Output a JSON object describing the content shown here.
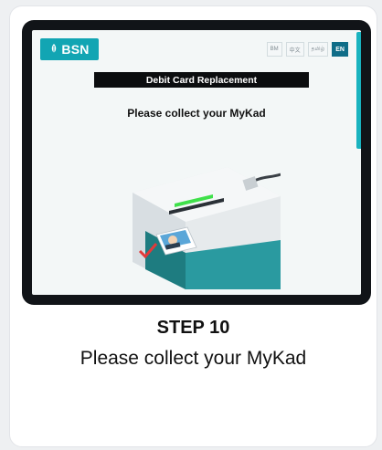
{
  "screen": {
    "brand": "BSN",
    "languages": [
      "BM",
      "中文",
      "தமிழ்",
      "EN"
    ],
    "active_language": "EN",
    "title": "Debit Card Replacement",
    "instruction": "Please collect your MyKad"
  },
  "caption": {
    "step": "STEP 10",
    "message": "Please collect your MyKad"
  },
  "colors": {
    "brand": "#12a5b3",
    "accent_bar": "#19b3bf",
    "kiosk_base": "#1e7c80",
    "slot_light": "#3fe04a"
  }
}
